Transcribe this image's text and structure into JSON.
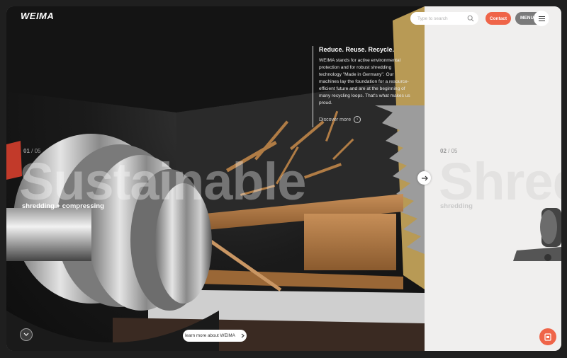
{
  "header": {
    "logo_text": "WEIMA",
    "search_placeholder": "Type to search",
    "contact_label": "Contact",
    "menu_label": "MENU"
  },
  "slides": [
    {
      "current": "01",
      "separator": " / ",
      "total": "05",
      "big_word": "Sustainable",
      "subtitle": "shredding + compressing",
      "info": {
        "title": "Reduce. Reuse. Recycle.",
        "text": "WEIMA stands for active environmental protection and for robust shredding technology \"Made in Germany\". Our machines lay the foundation for a resource-efficient future and are at the beginning of many recycling loops. That's what makes us proud.",
        "discover_label": "Discover more"
      },
      "learn_more_label": "learn more about WEIMA"
    },
    {
      "current": "02",
      "separator": " / ",
      "total": "05",
      "big_word": "Shred",
      "subtitle": "shredding"
    }
  ],
  "colors": {
    "accent": "#ef6448",
    "menu_bg": "#7a7a7a"
  },
  "icons": {
    "search": "search-icon",
    "next": "arrow-right-icon",
    "scroll": "chevron-down-icon",
    "learn_more": "chevron-right-icon",
    "chat": "chat-icon",
    "menu": "hamburger-icon"
  }
}
